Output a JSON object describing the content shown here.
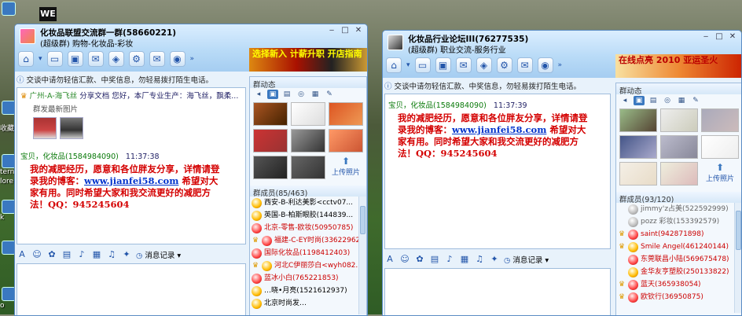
{
  "desktop": {
    "we_label": "WE",
    "labels": [
      "收藏",
      "ternet",
      "lore",
      "k",
      "o"
    ]
  },
  "win1": {
    "title": "化妆品联盟交流群一群(58660221)",
    "subtitle": "(超级群) 购物-化妆品-彩妆",
    "banner": "选择新入 计薪升职 开店指南",
    "notice": "交谈中请勿轻信汇款、中奖信息，勿轻易拨打陌生电话。",
    "share": {
      "name": "广州-A-海飞丝",
      "verb": "分享文档",
      "text": "您好，本厂专业生产：海飞丝，飘柔...",
      "title": "群发最新图片"
    },
    "msg": {
      "name": "宝贝，化妆品(1584984090)",
      "time": "11:37:38",
      "line1": "我的减肥经历，愿意和各位胖友分享，详情请登",
      "line2a": "录我的博客：",
      "link": "www.jianfei58.com",
      "line2b": " 希望对大",
      "line3": "家有用。同时希望大家和我交流更好的减肥方",
      "line4": "法！QQ：945245604"
    },
    "record": "消息记录",
    "panel": {
      "title": "群动态",
      "upload": "上传照片",
      "members_title": "群成员(85/463)",
      "members": [
        "西安-B-利达美影<cctv07...",
        "英国-B-柏斯眼胶(144839...",
        "北京-零售-欧妆(50950785)",
        "福建-C-EY时尚(33622962)",
        "国际化妆品(1198412403)",
        "河北C伊丽莎白<wyh082...",
        "蓝冰小白(765221853)",
        "…晓•月亮(1521612937)",
        "北京时尚发…"
      ]
    }
  },
  "win2": {
    "title": "化妆品行业论坛III(76277535)",
    "subtitle": "(超级群) 职业交流-服务行业",
    "banner": "在线点亮 2010 亚运圣火",
    "notice": "交谈中请勿轻信汇款、中奖信息，勿轻易拨打陌生电话。",
    "msg": {
      "name": "宝贝，化妆品(1584984090)",
      "time": "11:37:39",
      "line1": "我的减肥经历，愿意和各位胖友分享，详情请登",
      "line2a": "录我的博客：",
      "link": "www.jianfei58.com",
      "line2b": " 希望对大",
      "line3": "家有用。同时希望大家和我交流更好的减肥方",
      "line4": "法！QQ：945245604"
    },
    "record": "消息记录",
    "panel": {
      "title": "群动态",
      "upload": "上传照片",
      "members_title": "群成员(93/120)",
      "members": [
        "jimmy'z占美(522592999)",
        "pozz 彩妆(153392579)",
        "saint(942871898)",
        "Smile Angel(461240144)",
        "东莞联昌小陆(569675478)",
        "金华友亨塑胶(250133822)",
        "蓝天(365938054)",
        "欧钦行(36950875)"
      ]
    }
  }
}
